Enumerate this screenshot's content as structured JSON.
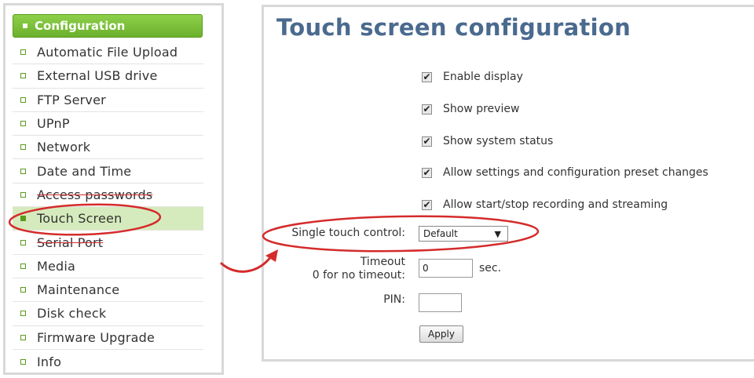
{
  "sidebar": {
    "header": "Configuration",
    "items": [
      {
        "label": "Automatic File Upload"
      },
      {
        "label": "External USB drive"
      },
      {
        "label": "FTP Server"
      },
      {
        "label": "UPnP"
      },
      {
        "label": "Network"
      },
      {
        "label": "Date and Time"
      },
      {
        "label": "Access passwords"
      },
      {
        "label": "Touch Screen",
        "active": true
      },
      {
        "label": "Serial Port"
      },
      {
        "label": "Media"
      },
      {
        "label": "Maintenance"
      },
      {
        "label": "Disk check"
      },
      {
        "label": "Firmware Upgrade"
      },
      {
        "label": "Info"
      }
    ]
  },
  "main": {
    "title": "Touch screen configuration",
    "checkboxes": [
      {
        "label": "Enable display",
        "checked": true
      },
      {
        "label": "Show preview",
        "checked": true
      },
      {
        "label": "Show system status",
        "checked": true
      },
      {
        "label": "Allow settings and configuration preset changes",
        "checked": true
      },
      {
        "label": "Allow start/stop recording and streaming",
        "checked": true
      }
    ],
    "single_touch": {
      "label": "Single touch control:",
      "value": "Default"
    },
    "timeout": {
      "label_line1": "Timeout",
      "label_line2": "0 for no timeout:",
      "value": "0",
      "unit": "sec."
    },
    "pin": {
      "label": "PIN:",
      "value": ""
    },
    "apply_label": "Apply"
  },
  "colors": {
    "accent_green": "#6bb02b",
    "active_bg": "#d6ebbd",
    "title_blue": "#4a6a8e",
    "annotation_red": "#d42b2b"
  }
}
